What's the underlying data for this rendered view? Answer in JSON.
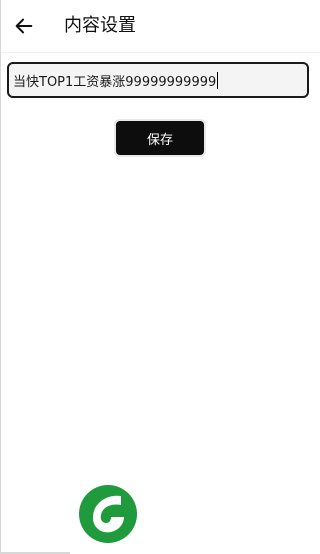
{
  "appbar": {
    "title": "内容设置",
    "back_icon": "arrow-left-icon"
  },
  "content_field": {
    "value": "当快TOP1工资暴涨99999999999"
  },
  "save_button": {
    "label": "保存"
  },
  "logo": {
    "icon": "green-leaf-logo",
    "colors": {
      "primary": "#1f9a3c",
      "leaf": "#ffffff"
    }
  },
  "colors": {
    "text": "#111111",
    "button_bg": "#0d0d0d",
    "field_bg": "#f4f4f4",
    "field_border": "#1a1a1a"
  }
}
